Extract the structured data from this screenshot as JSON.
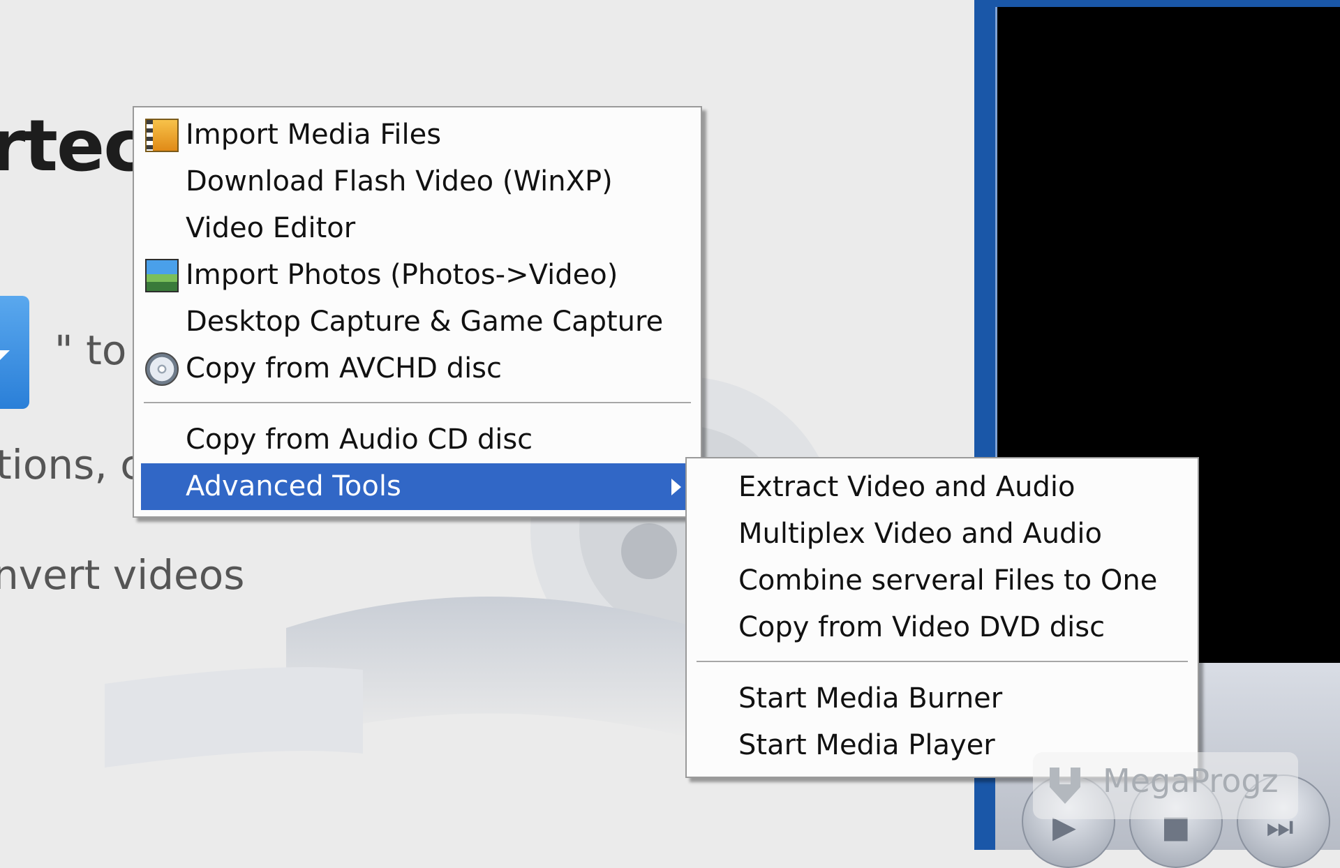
{
  "background": {
    "title_fragment": "rtec",
    "to_fragment": "\" to",
    "options_fragment": "tions, c",
    "convert_fragment": "nvert videos"
  },
  "context_menu": {
    "items": [
      {
        "label": "Import Media Files",
        "icon": "film-strip-icon"
      },
      {
        "label": "Download Flash Video (WinXP)",
        "icon": null
      },
      {
        "label": "Video Editor",
        "icon": null
      },
      {
        "label": "Import Photos (Photos->Video)",
        "icon": "photo-icon"
      },
      {
        "label": "Desktop Capture & Game Capture",
        "icon": null
      },
      {
        "label": "Copy from AVCHD disc",
        "icon": "disc-icon"
      },
      {
        "label": "Copy from Audio CD disc",
        "icon": null
      },
      {
        "label": "Advanced Tools",
        "icon": null,
        "has_submenu": true,
        "highlighted": true
      }
    ]
  },
  "submenu": {
    "parent": "Advanced Tools",
    "items": [
      {
        "label": "Extract Video and Audio"
      },
      {
        "label": "Multiplex Video and Audio"
      },
      {
        "label": "Combine serveral Files to One"
      },
      {
        "label": "Copy from Video DVD disc"
      },
      {
        "label": "Start Media Burner"
      },
      {
        "label": "Start Media Player"
      }
    ]
  },
  "watermark": {
    "text": "MegaProgz"
  },
  "colors": {
    "highlight": "#3167c6",
    "menu_bg": "#fcfcfc",
    "frame_blue": "#1a57a8"
  }
}
